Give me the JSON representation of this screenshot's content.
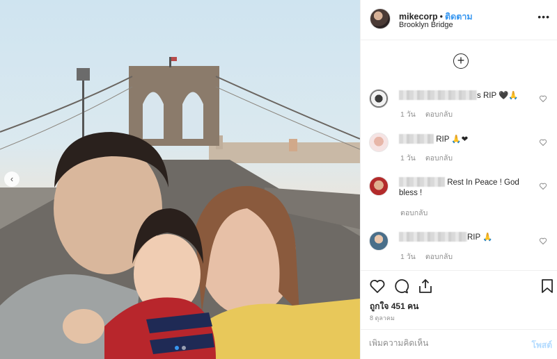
{
  "post": {
    "username": "mikecorp",
    "separator": "•",
    "follow_label": "ติดตาม",
    "location": "Brooklyn Bridge",
    "more_icon": "more-horizontal-icon"
  },
  "carousel": {
    "arrow_glyph": "‹",
    "slide_count": 2,
    "active_slide": 1
  },
  "load_more_glyph": "+",
  "comments": [
    {
      "text_suffix": "s RIP 🖤🙏",
      "time": "1 วัน",
      "reply": "ตอบกลับ"
    },
    {
      "text_suffix": " RIP 🙏❤",
      "time": "1 วัน",
      "reply": "ตอบกลับ"
    },
    {
      "text_suffix": " Rest In Peace ! God bless !",
      "time": "",
      "reply": "ตอบกลับ"
    },
    {
      "text_suffix": "RIP 🙏",
      "time": "1 วัน",
      "reply": "ตอบกลับ"
    }
  ],
  "actions": {
    "likes": "ถูกใจ 451 คน",
    "date": "8 ตุลาคม"
  },
  "add_comment": {
    "placeholder": "เพิ่มความคิดเห็น",
    "post_label": "โพสต์"
  },
  "colors": {
    "link": "#3897f0",
    "muted": "#8e8e8e",
    "post_disabled": "#b3dbff"
  }
}
